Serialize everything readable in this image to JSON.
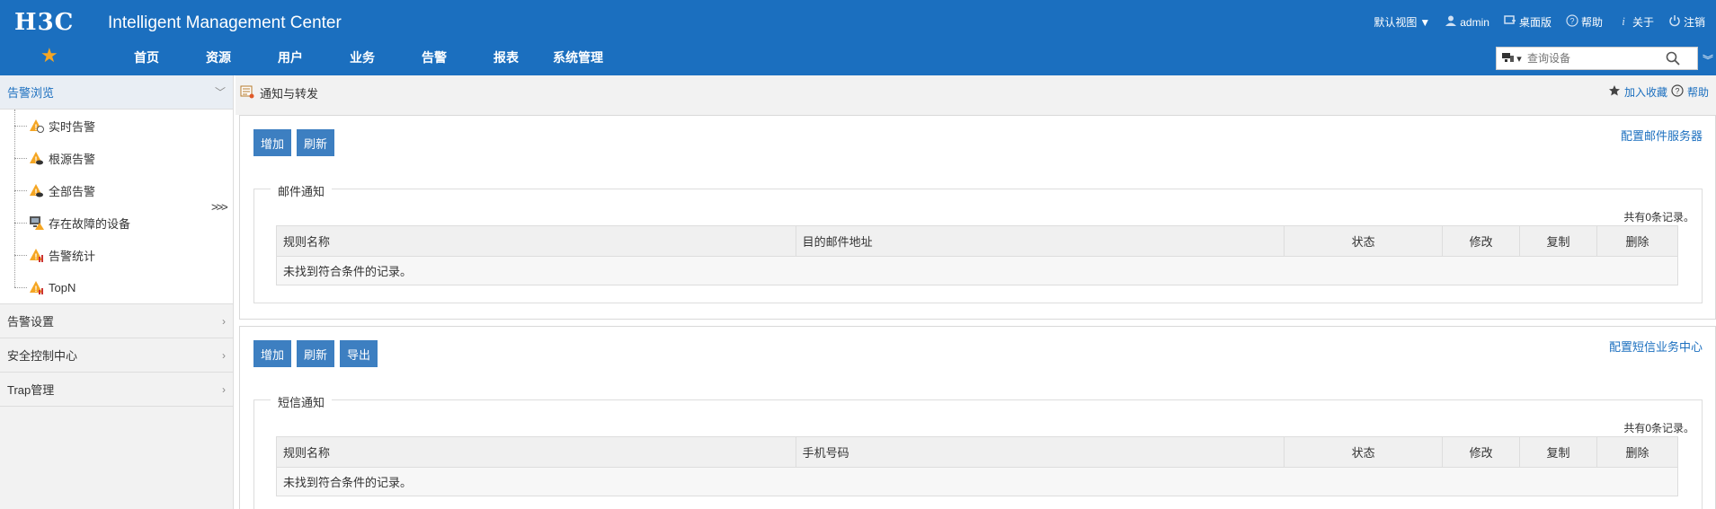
{
  "header": {
    "brand": "H3C",
    "product": "Intelligent Management Center",
    "links": {
      "view": "默认视图",
      "user": "admin",
      "desktop": "桌面版",
      "help": "帮助",
      "about": "关于",
      "logout": "注销"
    },
    "nav": [
      "首页",
      "资源",
      "用户",
      "业务",
      "告警",
      "报表",
      "系统管理"
    ],
    "search_placeholder": "查询设备"
  },
  "sidebar": {
    "active_section": "告警浏览",
    "items": [
      {
        "label": "实时告警",
        "icon": "alarm-realtime-icon"
      },
      {
        "label": "根源告警",
        "icon": "alarm-root-icon"
      },
      {
        "label": "全部告警",
        "icon": "alarm-all-icon"
      },
      {
        "label": "存在故障的设备",
        "icon": "faulty-device-icon"
      },
      {
        "label": "告警统计",
        "icon": "alarm-stats-icon"
      },
      {
        "label": "TopN",
        "icon": "alarm-topn-icon"
      }
    ],
    "expander": ">>>",
    "sections": [
      "告警设置",
      "安全控制中心",
      "Trap管理"
    ]
  },
  "breadcrumb": {
    "title": "通知与转发",
    "favorite": "加入收藏",
    "help": "帮助"
  },
  "email_panel": {
    "buttons": {
      "add": "增加",
      "refresh": "刷新"
    },
    "config_link": "配置邮件服务器",
    "legend": "邮件通知",
    "count": "共有0条记录。",
    "columns": [
      "规则名称",
      "目的邮件地址",
      "状态",
      "修改",
      "复制",
      "删除"
    ],
    "empty": "未找到符合条件的记录。"
  },
  "sms_panel": {
    "buttons": {
      "add": "增加",
      "refresh": "刷新",
      "export": "导出"
    },
    "config_link": "配置短信业务中心",
    "legend": "短信通知",
    "count": "共有0条记录。",
    "columns": [
      "规则名称",
      "手机号码",
      "状态",
      "修改",
      "复制",
      "删除"
    ],
    "empty": "未找到符合条件的记录。"
  },
  "colors": {
    "header_bg": "#1b6fbf",
    "button_bg": "#3d7fc1",
    "star": "#f5a623"
  }
}
